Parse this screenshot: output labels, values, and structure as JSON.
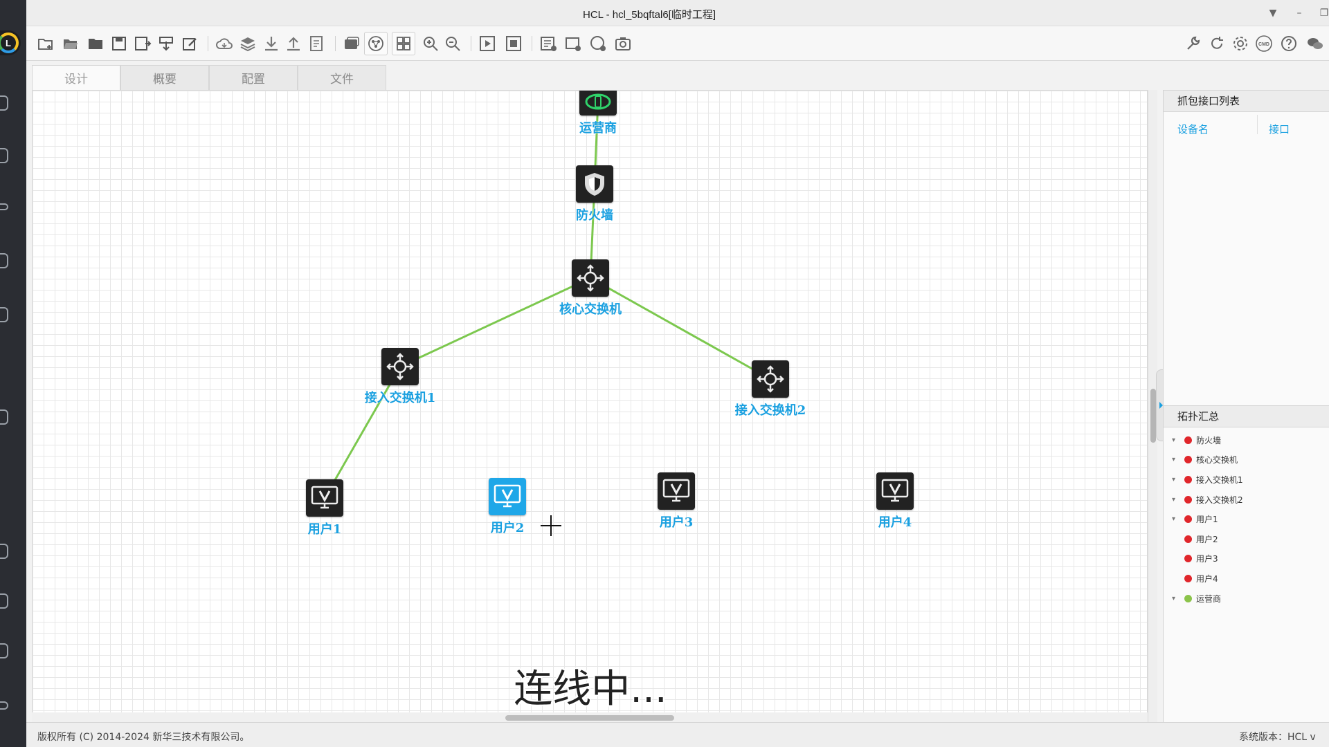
{
  "window": {
    "title": "HCL - hcl_5bqftal6[临时工程]"
  },
  "tabs": [
    {
      "label": "设计",
      "active": true
    },
    {
      "label": "概要",
      "active": false
    },
    {
      "label": "配置",
      "active": false
    },
    {
      "label": "文件",
      "active": false
    }
  ],
  "toolbar": {
    "left_icons": [
      "new-project-icon",
      "open-project-icon",
      "open-folder-icon",
      "save-icon",
      "save-as-icon",
      "import-icon",
      "edit-icon",
      "cloud-icon",
      "layers-icon",
      "download-icon",
      "upload-icon",
      "export-icon",
      "capture-image-icon",
      "topology-icon",
      "grid-icon",
      "zoom-in-icon",
      "zoom-out-icon",
      "start-icon",
      "stop-icon",
      "list-icon",
      "add-rect-icon",
      "add-circle-icon",
      "screenshot-icon"
    ],
    "right_icons": [
      "tools-icon",
      "refresh-icon",
      "settings-icon",
      "cmd-icon",
      "help-icon",
      "wechat-icon"
    ],
    "cmd_label": "CMD"
  },
  "topology": {
    "devices": [
      {
        "id": "isp",
        "label": "运营商",
        "type": "cloud",
        "selected": false
      },
      {
        "id": "fw",
        "label": "防火墙",
        "type": "firewall",
        "selected": false
      },
      {
        "id": "core",
        "label": "核心交换机",
        "type": "switch",
        "selected": false
      },
      {
        "id": "acc1",
        "label": "接入交换机1",
        "type": "switch",
        "selected": false
      },
      {
        "id": "acc2",
        "label": "接入交换机2",
        "type": "switch",
        "selected": false
      },
      {
        "id": "u1",
        "label": "用户1",
        "type": "host",
        "selected": false
      },
      {
        "id": "u2",
        "label": "用户2",
        "type": "host",
        "selected": true
      },
      {
        "id": "u3",
        "label": "用户3",
        "type": "host",
        "selected": false
      },
      {
        "id": "u4",
        "label": "用户4",
        "type": "host",
        "selected": false
      }
    ],
    "links": [
      {
        "from": "isp",
        "to": "fw"
      },
      {
        "from": "fw",
        "to": "core"
      },
      {
        "from": "core",
        "to": "acc1"
      },
      {
        "from": "core",
        "to": "acc2"
      },
      {
        "from": "acc1",
        "to": "u1"
      }
    ],
    "link_color": "#7cc84e",
    "label_color": "#1aa0e0"
  },
  "caption": "连线中...",
  "capture_panel": {
    "title": "抓包接口列表",
    "col_device": "设备名",
    "col_interface": "接口"
  },
  "topo_summary": {
    "title": "拓扑汇总",
    "items": [
      {
        "label": "防火墙",
        "status_color": "#e0262b",
        "expandable": true
      },
      {
        "label": "核心交换机",
        "status_color": "#e0262b",
        "expandable": true
      },
      {
        "label": "接入交换机1",
        "status_color": "#e0262b",
        "expandable": true
      },
      {
        "label": "接入交换机2",
        "status_color": "#e0262b",
        "expandable": true
      },
      {
        "label": "用户1",
        "status_color": "#e0262b",
        "expandable": true
      },
      {
        "label": "用户2",
        "status_color": "#e0262b",
        "expandable": false
      },
      {
        "label": "用户3",
        "status_color": "#e0262b",
        "expandable": false
      },
      {
        "label": "用户4",
        "status_color": "#e0262b",
        "expandable": false
      },
      {
        "label": "运营商",
        "status_color": "#8bc34a",
        "expandable": true
      }
    ]
  },
  "statusbar": {
    "copyright": "版权所有 (C) 2014-2024 新华三技术有限公司。",
    "version": "系统版本：HCL v"
  }
}
